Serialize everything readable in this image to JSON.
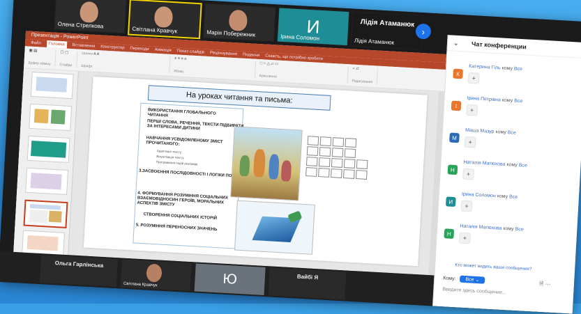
{
  "participants_top": [
    {
      "name": "Олена Стрелкова",
      "type": "video",
      "active": false
    },
    {
      "name": "Світлана Кравчук",
      "type": "video",
      "active": true
    },
    {
      "name": "Марія Побережник",
      "type": "video",
      "active": false
    },
    {
      "name": "Ірина Соломон",
      "type": "initial",
      "initial": "И",
      "active": false
    },
    {
      "name": "Лідія Атаманюк",
      "type": "name_only",
      "display": "Лідія Атаманюк",
      "active": false
    }
  ],
  "participants_bottom": [
    {
      "name": "Ольга Гарлінська",
      "type": "name_only"
    },
    {
      "name": "Світлана Кравчук",
      "type": "video"
    },
    {
      "name": "Ю",
      "type": "initial"
    },
    {
      "name": "Вайбі Я",
      "type": "name_only"
    }
  ],
  "ppt": {
    "title": "Презентація - PowerPoint",
    "tabs": [
      "Файл",
      "Головна",
      "Вставлення",
      "Конструктор",
      "Переходи",
      "Анімація",
      "Показ слайдів",
      "Рецензування",
      "Подання",
      "Скажіть, що потрібно зробити"
    ],
    "selected_tab": "Головна",
    "groups": [
      "Буфер обміну",
      "Слайди",
      "Шрифт",
      "Абзац",
      "Креслення",
      "Редагування"
    ]
  },
  "slide": {
    "title": "На уроках читання та письма:",
    "bullets": [
      "ВИКОРИСТАННЯ ГЛОБАЛЬНОГО ЧИТАННЯ",
      "ПЕРШІ СЛОВА, РЕЧЕННЯ, ТЕКСТИ ПІДБИРАТИ ЗА ІНТЕРЕСАМИ ДИТИНИ",
      "НАВЧАННЯ УСВІДОМЛЕНОМУ ЗМІСТ ПРОЧИТАНОГО:",
      "3.ЗАСВОЄННЯ ПОСЛІДОВНОСТІ І ЛОГІКИ ПОДІ",
      "4. ФОРМУВАННЯ РОЗУМІННЯ СОЦІАЛЬНИХ ВЗАЄМОВІДНОСИН ГЕРОЇВ, МОРАЛЬНИХ АСПЕКТІВ ЗМІСТУ",
      "СТВОРЕННЯ СОЦІАЛЬНИХ ІСТОРІЙ",
      "5. РОЗУМІННЯ ПЕРЕНОСНИХ ЗНАЧЕНЬ"
    ],
    "subitems": [
      "Адаптація тексту",
      "Візуалізація тексту",
      "Програвання подій розповіді"
    ]
  },
  "chat": {
    "title": "Чат конференции",
    "messages": [
      {
        "sender": "Катерина Гіль",
        "to": "кому",
        "target": "Все",
        "initial": "К",
        "color": "#e8762d"
      },
      {
        "sender": "Ірина Петрівна",
        "to": "кому",
        "target": "Все",
        "initial": "І",
        "color": "#e8762d"
      },
      {
        "sender": "Маша Мазур",
        "to": "кому",
        "target": "Все",
        "initial": "М",
        "color": "#2d6bb8"
      },
      {
        "sender": "Наталія Матюхова",
        "to": "кому",
        "target": "Все",
        "initial": "Н",
        "color": "#2aa35a"
      },
      {
        "sender": "Ірина Соломон",
        "to": "кому",
        "target": "Все",
        "initial": "И",
        "color": "#1f8d95"
      },
      {
        "sender": "Наталія Матюхова",
        "to": "кому",
        "target": "Все",
        "initial": "Н",
        "color": "#2aa35a"
      }
    ],
    "who_can_see": "Кто может видеть ваши сообщения?",
    "to_label": "Кому:",
    "to_value": "Все",
    "input_placeholder": "Введите здесь сообщение..."
  },
  "icons": {
    "next": "chevron-right-icon",
    "dropdown": "chevron-down-icon",
    "file": "file-icon",
    "more": "more-icon"
  }
}
